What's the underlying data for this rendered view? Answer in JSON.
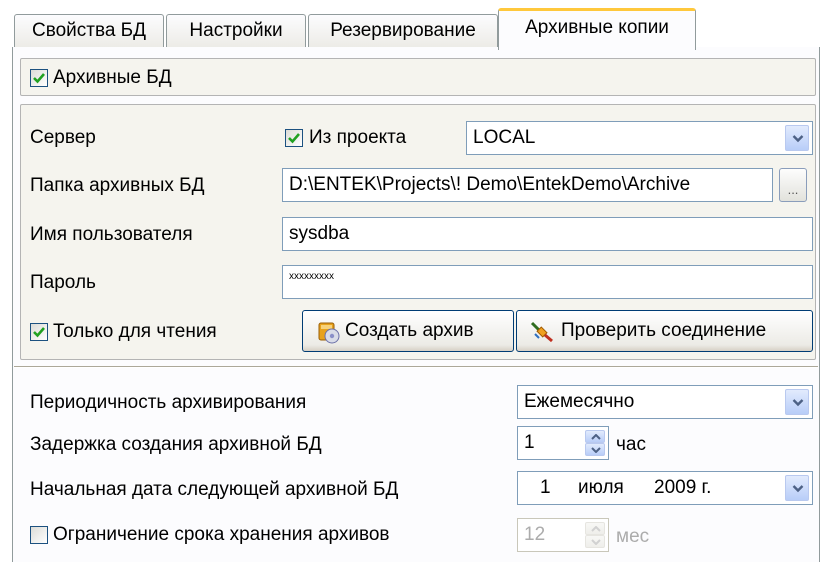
{
  "tabs": [
    {
      "label": "Свойства БД",
      "active": false
    },
    {
      "label": "Настройки",
      "active": false
    },
    {
      "label": "Резервирование",
      "active": false
    },
    {
      "label": "Архивные копии",
      "active": true
    }
  ],
  "archive_db": {
    "label": "Архивные БД",
    "checked": true
  },
  "server": {
    "label": "Сервер",
    "from_project": {
      "label": "Из проекта",
      "checked": true
    },
    "value": "LOCAL"
  },
  "folder": {
    "label": "Папка архивных БД",
    "value": "D:\\ENTEK\\Projects\\! Demo\\EntekDemo\\Archive",
    "browse_label": "..."
  },
  "username": {
    "label": "Имя пользователя",
    "value": "sysdba"
  },
  "password": {
    "label": "Пароль",
    "value": "xxxxxxxxx"
  },
  "read_only": {
    "label": "Только для чтения",
    "checked": true
  },
  "buttons": {
    "create_archive": "Создать архив",
    "check_connection": "Проверить соединение"
  },
  "periodicity": {
    "label": "Периодичность архивирования",
    "value": "Ежемесячно"
  },
  "delay": {
    "label": "Задержка создания архивной БД",
    "value": "1",
    "unit": "час"
  },
  "start_date": {
    "label": "Начальная дата следующей архивной БД",
    "day": "1",
    "month": "июля",
    "year": "2009 г."
  },
  "retention": {
    "label": "Ограничение срока хранения архивов",
    "checked": false,
    "value": "12",
    "unit": "мес"
  },
  "colors": {
    "accent_tab": "#ffc83c",
    "checkmark": "#21a121",
    "panel": "#f5f4ee"
  }
}
